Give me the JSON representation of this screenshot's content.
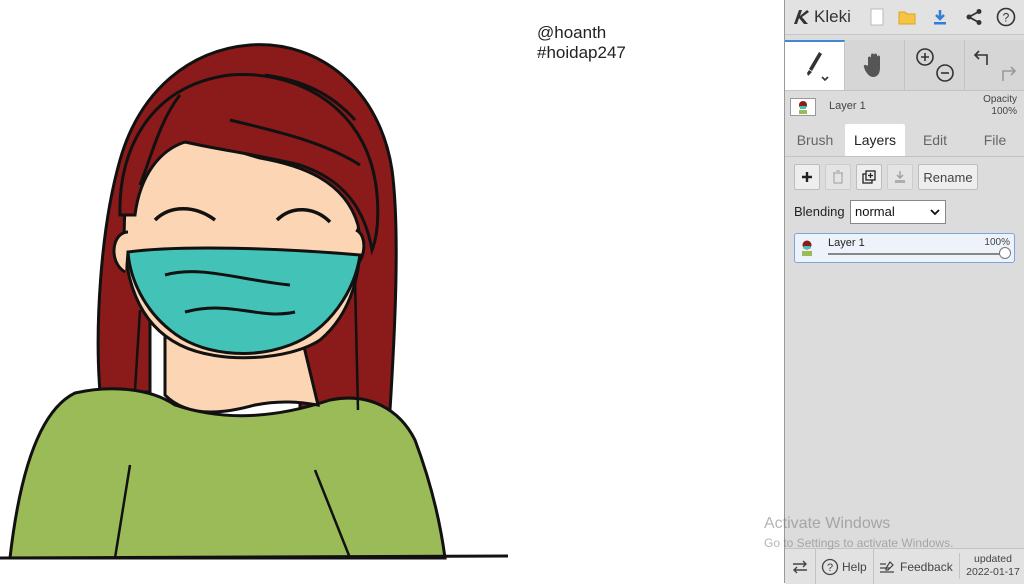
{
  "canvas": {
    "text_line1": "@hoanth",
    "text_line2": "#hoidap247"
  },
  "watermark": {
    "title": "Activate Windows",
    "subtitle": "Go to Settings to activate Windows."
  },
  "app": {
    "name": "Kleki",
    "top_icons": [
      "new-file-icon",
      "open-folder-icon",
      "download-icon",
      "share-icon",
      "help-icon"
    ]
  },
  "tools": {
    "items": [
      "brush-tool-icon",
      "hand-tool-icon",
      "zoom-icon",
      "undo-redo-icon"
    ],
    "active": "brush"
  },
  "layer_info": {
    "name": "Layer 1",
    "opacity_label": "Opacity",
    "opacity_value": "100%"
  },
  "tabs": [
    {
      "label": "Brush",
      "active": false
    },
    {
      "label": "Layers",
      "active": true
    },
    {
      "label": "Edit",
      "active": false
    },
    {
      "label": "File",
      "active": false
    }
  ],
  "layers": {
    "rename_label": "Rename",
    "blending_label": "Blending",
    "blending_value": "normal",
    "items": [
      {
        "name": "Layer 1",
        "opacity": "100%",
        "opacity_fraction": 1.0
      }
    ]
  },
  "bottom": {
    "help_label": "Help",
    "feedback_label": "Feedback",
    "updated_label": "updated",
    "updated_date": "2022-01-17"
  },
  "colors": {
    "accent": "#3e88d6",
    "hair": "#8b1a1a",
    "skin": "#fcd5b5",
    "mask": "#43c2b7",
    "shirt": "#9bbb59",
    "panel_bg": "#dcdcdc"
  }
}
